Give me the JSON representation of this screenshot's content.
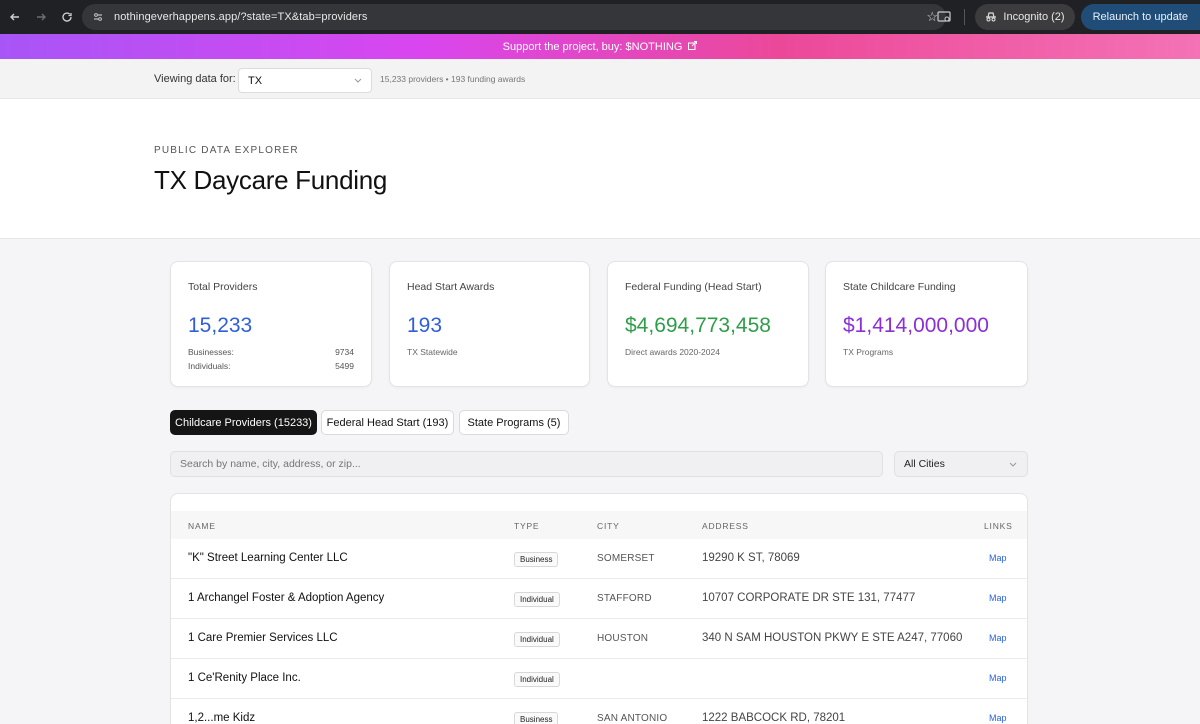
{
  "browser": {
    "url": "nothingeverhappens.app/?state=TX&tab=providers",
    "incognito_label": "Incognito (2)",
    "relaunch_label": "Relaunch to update"
  },
  "banner": {
    "text": "Support the project, buy: $NOTHING"
  },
  "filter": {
    "label": "Viewing data for:",
    "selected_state": "TX",
    "summary": "15,233 providers • 193 funding awards"
  },
  "hero": {
    "eyebrow": "PUBLIC DATA EXPLORER",
    "title": "TX Daycare Funding"
  },
  "cards": {
    "providers": {
      "title": "Total Providers",
      "value": "15,233",
      "businesses_label": "Businesses:",
      "businesses_value": "9734",
      "individuals_label": "Individuals:",
      "individuals_value": "5499",
      "color": "#2f5fd8"
    },
    "headstart": {
      "title": "Head Start Awards",
      "value": "193",
      "sub": "TX Statewide",
      "color": "#2f5fd8"
    },
    "federal": {
      "title": "Federal Funding (Head Start)",
      "value": "$4,694,773,458",
      "sub": "Direct awards 2020-2024",
      "color": "#2f9e4a"
    },
    "state": {
      "title": "State Childcare Funding",
      "value": "$1,414,000,000",
      "sub": "TX Programs",
      "color": "#8b2fd8"
    }
  },
  "tabs": [
    {
      "label": "Childcare Providers (15233)",
      "active": true
    },
    {
      "label": "Federal Head Start (193)",
      "active": false
    },
    {
      "label": "State Programs (5)",
      "active": false
    }
  ],
  "search": {
    "placeholder": "Search by name, city, address, or zip..."
  },
  "city_filter": {
    "selected": "All Cities"
  },
  "table": {
    "headers": {
      "name": "NAME",
      "type": "TYPE",
      "city": "CITY",
      "address": "ADDRESS",
      "links": "LINKS"
    },
    "rows": [
      {
        "name": "\"K\" Street Learning Center LLC",
        "type": "Business",
        "city": "SOMERSET",
        "address": "19290 K ST, 78069",
        "link": "Map"
      },
      {
        "name": "1 Archangel Foster & Adoption Agency",
        "type": "Individual",
        "city": "STAFFORD",
        "address": "10707 CORPORATE DR STE 131, 77477",
        "link": "Map"
      },
      {
        "name": "1 Care Premier Services LLC",
        "type": "Individual",
        "city": "HOUSTON",
        "address": "340 N SAM HOUSTON PKWY E STE A247, 77060",
        "link": "Map"
      },
      {
        "name": "1 Ce'Renity Place Inc.",
        "type": "Individual",
        "city": "",
        "address": "",
        "link": "Map"
      },
      {
        "name": "1,2...me Kidz",
        "type": "Business",
        "city": "SAN ANTONIO",
        "address": "1222 BABCOCK RD, 78201",
        "link": "Map"
      }
    ]
  }
}
